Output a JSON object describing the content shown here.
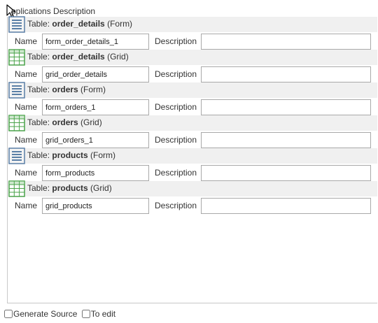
{
  "section": {
    "title": "pplications Description"
  },
  "blocks": [
    {
      "prefix": "Table: ",
      "name": "order_details",
      "suffix": " (Form)",
      "kind": "form",
      "name_label": "Name",
      "name_value": "form_order_details_1",
      "desc_label": "Description",
      "desc_value": ""
    },
    {
      "prefix": "Table: ",
      "name": "order_details",
      "suffix": " (Grid)",
      "kind": "grid",
      "name_label": "Name",
      "name_value": "grid_order_details",
      "desc_label": "Description",
      "desc_value": ""
    },
    {
      "prefix": "Table: ",
      "name": "orders",
      "suffix": " (Form)",
      "kind": "form",
      "name_label": "Name",
      "name_value": "form_orders_1",
      "desc_label": "Description",
      "desc_value": ""
    },
    {
      "prefix": "Table: ",
      "name": "orders",
      "suffix": " (Grid)",
      "kind": "grid",
      "name_label": "Name",
      "name_value": "grid_orders_1",
      "desc_label": "Description",
      "desc_value": ""
    },
    {
      "prefix": "Table: ",
      "name": "products",
      "suffix": " (Form)",
      "kind": "form",
      "name_label": "Name",
      "name_value": "form_products",
      "desc_label": "Description",
      "desc_value": ""
    },
    {
      "prefix": "Table: ",
      "name": "products",
      "suffix": " (Grid)",
      "kind": "grid",
      "name_label": "Name",
      "name_value": "grid_products",
      "desc_label": "Description",
      "desc_value": ""
    }
  ],
  "footer": {
    "generate_source_label": "Generate Source",
    "to_edit_label": "To edit"
  },
  "colors": {
    "header_bg": "#f0f0f0",
    "form_icon": "#5a7fa6",
    "grid_icon": "#4aa34a",
    "border": "#c8c8c8"
  }
}
